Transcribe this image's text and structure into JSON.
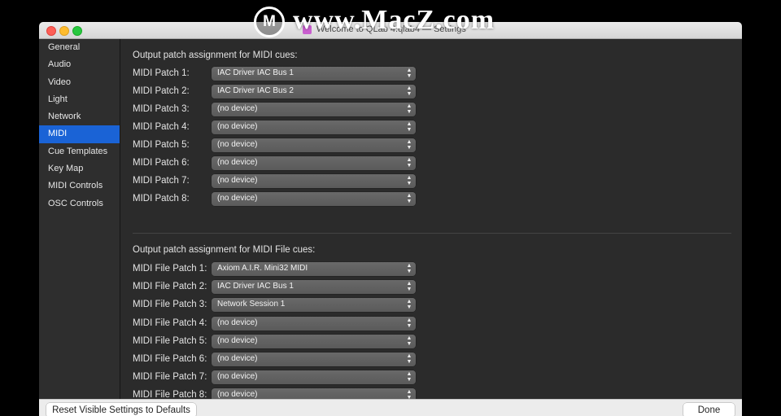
{
  "watermark": {
    "logo": "M",
    "text": "www.MacZ.com"
  },
  "window": {
    "title": "Welcome to QLab 4.qlab4 — Settings"
  },
  "sidebar": {
    "items": [
      {
        "label": "General"
      },
      {
        "label": "Audio"
      },
      {
        "label": "Video"
      },
      {
        "label": "Light"
      },
      {
        "label": "Network"
      },
      {
        "label": "MIDI",
        "selected": true
      },
      {
        "label": "Cue Templates"
      },
      {
        "label": "Key Map"
      },
      {
        "label": "MIDI Controls"
      },
      {
        "label": "OSC Controls"
      }
    ]
  },
  "midi_section": {
    "title": "Output patch assignment for MIDI cues:",
    "patches": [
      {
        "label": "MIDI Patch 1:",
        "value": "IAC Driver IAC Bus 1"
      },
      {
        "label": "MIDI Patch 2:",
        "value": "IAC Driver IAC Bus 2"
      },
      {
        "label": "MIDI Patch 3:",
        "value": "(no device)"
      },
      {
        "label": "MIDI Patch 4:",
        "value": "(no device)"
      },
      {
        "label": "MIDI Patch 5:",
        "value": "(no device)"
      },
      {
        "label": "MIDI Patch 6:",
        "value": "(no device)"
      },
      {
        "label": "MIDI Patch 7:",
        "value": "(no device)"
      },
      {
        "label": "MIDI Patch 8:",
        "value": "(no device)"
      }
    ]
  },
  "midi_file_section": {
    "title": "Output patch assignment for MIDI File cues:",
    "patches": [
      {
        "label": "MIDI File Patch 1:",
        "value": "Axiom A.I.R. Mini32 MIDI"
      },
      {
        "label": "MIDI File Patch 2:",
        "value": "IAC Driver IAC Bus 1"
      },
      {
        "label": "MIDI File Patch 3:",
        "value": "Network Session 1"
      },
      {
        "label": "MIDI File Patch 4:",
        "value": "(no device)"
      },
      {
        "label": "MIDI File Patch 5:",
        "value": "(no device)"
      },
      {
        "label": "MIDI File Patch 6:",
        "value": "(no device)"
      },
      {
        "label": "MIDI File Patch 7:",
        "value": "(no device)"
      },
      {
        "label": "MIDI File Patch 8:",
        "value": "(no device)"
      }
    ]
  },
  "footer": {
    "reset_label": "Reset Visible Settings to Defaults",
    "done_label": "Done"
  },
  "icons": {
    "popup_arrows": "updown-chevron-icon"
  },
  "colors": {
    "selection": "#1a63d6",
    "background": "#2b2b2b"
  }
}
